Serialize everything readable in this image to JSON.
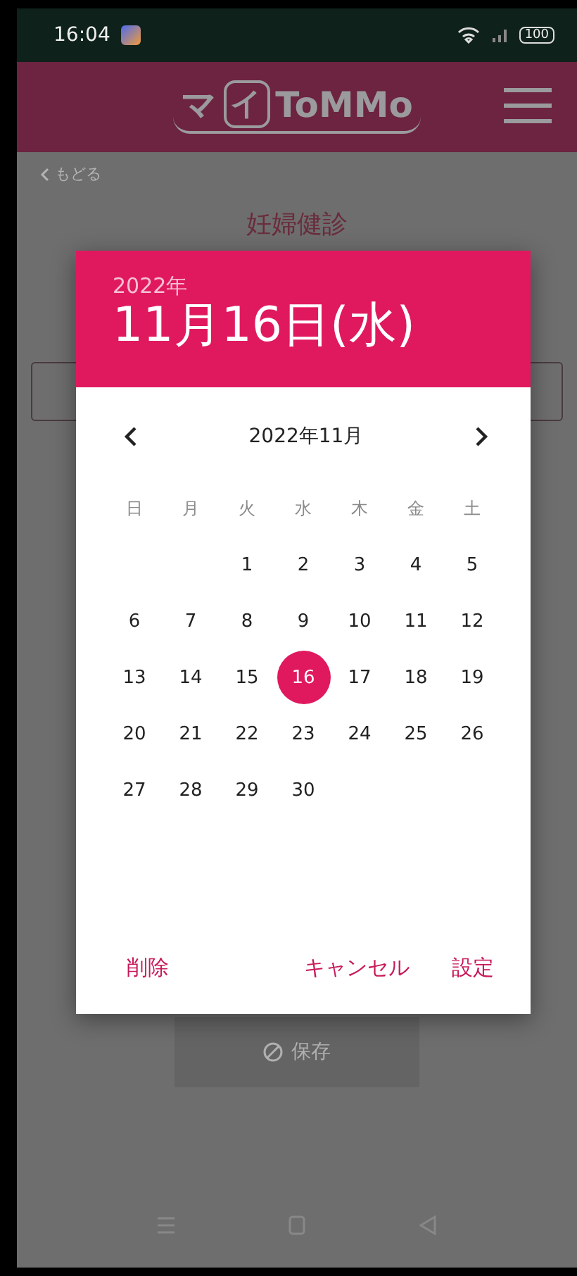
{
  "status_bar": {
    "time": "16:04",
    "battery": "100"
  },
  "header": {
    "logo_parts": [
      "マ",
      "イ",
      "ToMMo"
    ]
  },
  "page": {
    "back_link": "もどる",
    "title": "妊婦健診",
    "save_button": "保存"
  },
  "date_picker": {
    "year": "2022年",
    "date": "11月16日(水)",
    "month_label": "2022年11月",
    "weekdays": [
      "日",
      "月",
      "火",
      "水",
      "木",
      "金",
      "土"
    ],
    "weeks": [
      {
        "days": [
          {
            "label": "1",
            "selected": false
          },
          {
            "label": "2",
            "selected": false
          },
          {
            "label": "3",
            "selected": false
          },
          {
            "label": "4",
            "selected": false
          },
          {
            "label": "5",
            "selected": false
          }
        ]
      },
      {
        "days": [
          {
            "label": "6",
            "selected": false
          },
          {
            "label": "7",
            "selected": false
          },
          {
            "label": "8",
            "selected": false
          },
          {
            "label": "9",
            "selected": false
          },
          {
            "label": "10",
            "selected": false
          },
          {
            "label": "11",
            "selected": false
          },
          {
            "label": "12",
            "selected": false
          }
        ]
      },
      {
        "days": [
          {
            "label": "13",
            "selected": false
          },
          {
            "label": "14",
            "selected": false
          },
          {
            "label": "15",
            "selected": false
          },
          {
            "label": "16",
            "selected": true
          },
          {
            "label": "17",
            "selected": false
          },
          {
            "label": "18",
            "selected": false
          },
          {
            "label": "19",
            "selected": false
          }
        ]
      },
      {
        "days": [
          {
            "label": "20",
            "selected": false
          },
          {
            "label": "21",
            "selected": false
          },
          {
            "label": "22",
            "selected": false
          },
          {
            "label": "23",
            "selected": false
          },
          {
            "label": "24",
            "selected": false
          },
          {
            "label": "25",
            "selected": false
          },
          {
            "label": "26",
            "selected": false
          }
        ]
      },
      {
        "days": [
          {
            "label": "27",
            "selected": false
          },
          {
            "label": "28",
            "selected": false
          },
          {
            "label": "29",
            "selected": false
          },
          {
            "label": "30",
            "selected": false
          }
        ]
      }
    ],
    "actions": [
      {
        "label": "削除",
        "kind": "delete"
      },
      {
        "label": "キャンセル",
        "kind": "cancel"
      },
      {
        "label": "設定",
        "kind": "confirm"
      }
    ]
  }
}
